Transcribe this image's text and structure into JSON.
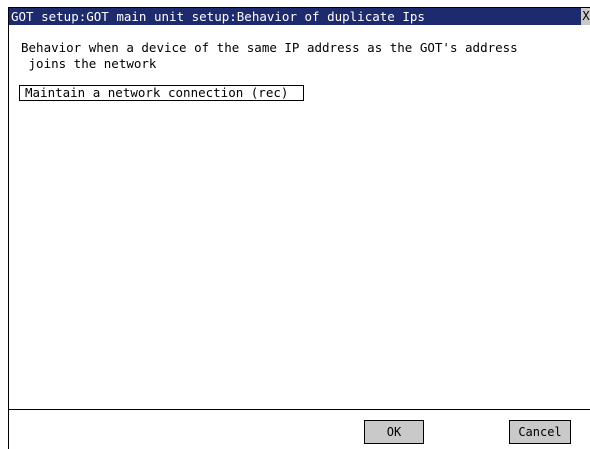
{
  "window": {
    "title": "GOT setup:GOT main unit setup:Behavior of duplicate Ips",
    "close_glyph": "X"
  },
  "content": {
    "description": "Behavior when a device of the same IP address as the GOT's address\n joins the network",
    "selected_option": "Maintain a network connection (rec)"
  },
  "buttons": {
    "ok_label": "OK",
    "cancel_label": "Cancel"
  },
  "colors": {
    "titlebar": "#1e2a6e",
    "button_face": "#c9c9c9"
  }
}
